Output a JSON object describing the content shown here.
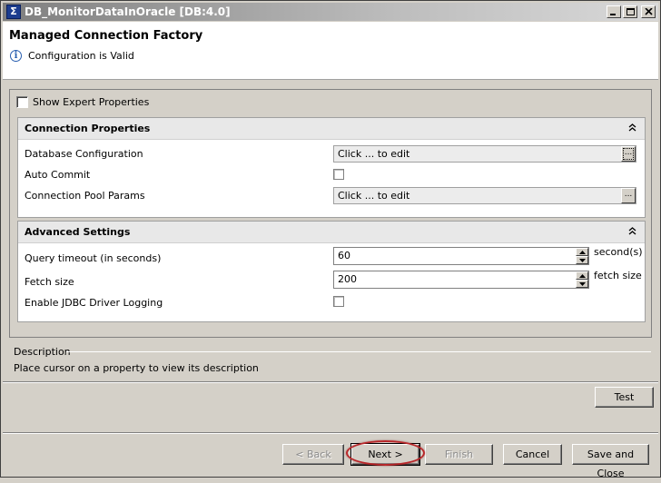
{
  "window": {
    "title": "DB_MonitorDataInOracle [DB:4.0]"
  },
  "header": {
    "title": "Managed Connection Factory",
    "status_text": "Configuration is Valid",
    "status_icon": "info-icon"
  },
  "expert": {
    "label": "Show Expert Properties",
    "checked": false
  },
  "connection_section": {
    "title": "Connection Properties",
    "rows": [
      {
        "label": "Database Configuration",
        "value": "Click ... to edit",
        "button": "..."
      },
      {
        "label": "Auto Commit",
        "checked": false
      },
      {
        "label": "Connection Pool Params",
        "value": "Click ... to edit",
        "button": "..."
      }
    ]
  },
  "advanced_section": {
    "title": "Advanced Settings",
    "rows": [
      {
        "label": "Query timeout (in seconds)",
        "value": "60",
        "unit": "second(s)"
      },
      {
        "label": "Fetch size",
        "value": "200",
        "unit": "fetch size"
      },
      {
        "label": "Enable JDBC Driver Logging",
        "checked": false
      }
    ]
  },
  "description": {
    "title": "Description",
    "text": "Place cursor on a property to view its description"
  },
  "buttons": {
    "test": "Test",
    "back": "< Back",
    "next": "Next >",
    "finish": "Finish",
    "cancel": "Cancel",
    "save_close": "Save and Close"
  },
  "colors": {
    "highlight": "#b9272a",
    "info": "#2a5fb0"
  }
}
